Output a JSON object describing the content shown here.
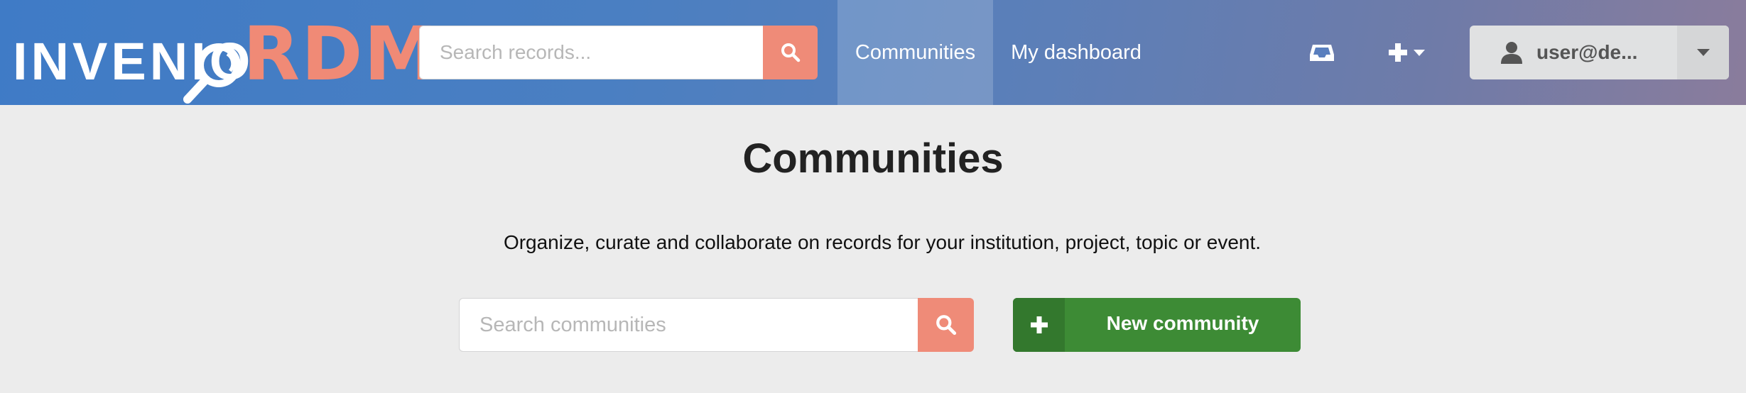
{
  "header": {
    "logo": {
      "text_left": "INVENIO",
      "text_right": "RDM"
    },
    "search": {
      "placeholder": "Search records..."
    },
    "nav": [
      {
        "label": "Communities",
        "active": true
      },
      {
        "label": "My dashboard",
        "active": false
      }
    ],
    "icons": {
      "inbox": "inbox-icon",
      "new": "plus-icon",
      "user": "user-icon"
    },
    "user": {
      "label": "user@de..."
    }
  },
  "main": {
    "title": "Communities",
    "description": "Organize, curate and collaborate on records for your institution, project, topic or event.",
    "search": {
      "placeholder": "Search communities"
    },
    "new_button": {
      "label": "New community"
    }
  },
  "colors": {
    "accent": "#ef8b78",
    "primary_green": "#3d8b35",
    "header_blue": "#3f7bc6"
  }
}
